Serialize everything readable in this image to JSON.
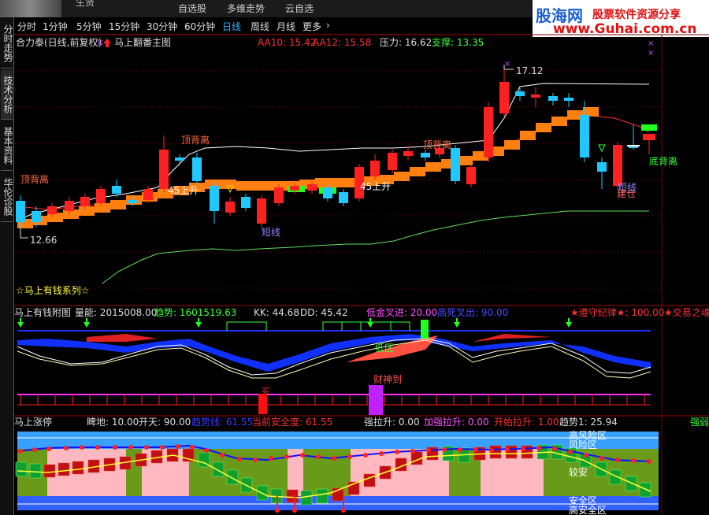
{
  "app": {
    "topbar": {
      "user_label": "生贤",
      "tabs": [
        "自选股",
        "多维走势",
        "云自选"
      ]
    },
    "periods": [
      "分时",
      "1分钟",
      "5分钟",
      "15分钟",
      "30分钟",
      "60分钟",
      "日线",
      "周线",
      "月线",
      "更多"
    ],
    "active_period": "日线",
    "period_arrow": "›",
    "side_tabs": [
      "分时走势",
      "技术分析",
      "基本资料",
      "华伦诊股"
    ],
    "ad": {
      "brand": "股海网",
      "slogan": "股票软件资源分享",
      "url": "www.Guhai.com.cn"
    }
  },
  "main_panel": {
    "title": "合力泰(日线,前复权)",
    "marker": "×",
    "indicator_name": "马上翻番主图",
    "aa10": "AA10: 15.42",
    "aa12": "AA12: 15.58",
    "pressure": "压力: 16.62",
    "support": "支撑: 13.35",
    "price_high": "17.12",
    "price_low": "12.66",
    "footer": "☆马上有钱系列☆",
    "annotations": [
      "顶背离",
      "顶背离",
      "顶背离",
      "45上升",
      "45上升",
      "短线",
      "短线",
      "底背离",
      "建仓"
    ]
  },
  "panel2": {
    "title": "马上有钱附图",
    "volume": "量能: 2015008.00",
    "trend": "趋势: 1601519.63",
    "kk": "KK: 44.68",
    "dd": "DD: 45.42",
    "low_cross": "低金叉进: 20.00",
    "high_cross": "高死叉出: 90.00",
    "discipline": "★遵守纪律★: 100.00",
    "trade": "★交易之魂",
    "label_lowzone": "低区",
    "label_wealth": "财神到",
    "label_buy": "买"
  },
  "panel3": {
    "title": "马上涨停",
    "bottom": "睥地: 10.00",
    "sky": "开天: 90.00",
    "trend_line": "趋势线: 61.55",
    "safety": "当前安全度: 61.55",
    "strong": "强拉升: 0.00",
    "accel": "加强拉升: 0.00",
    "start": "开始拉升: 1.00",
    "trend1": "趋势1: 25.94",
    "strong2": "强弱",
    "zones": [
      "高风险区",
      "风险区",
      "安全区",
      "高安全区"
    ],
    "mid_label": "较安"
  },
  "colors": {
    "up": "#ff2020",
    "down": "#20c8ff",
    "grid": "#600000",
    "accent": "#3a3aff"
  }
}
